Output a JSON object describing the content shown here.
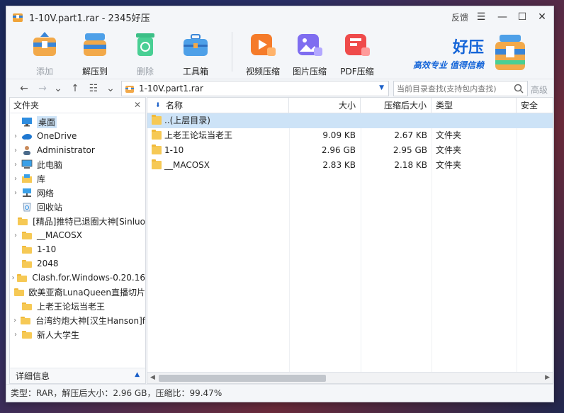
{
  "window": {
    "title": "1-10V.part1.rar - 2345好压",
    "feedback": "反馈"
  },
  "toolbar": {
    "add": "添加",
    "extract": "解压到",
    "delete": "删除",
    "tools": "工具箱",
    "video": "视频压缩",
    "image": "图片压缩",
    "pdf": "PDF压缩"
  },
  "brand": {
    "title": "好压",
    "slogan": "高效专业 值得信赖"
  },
  "address": {
    "path": "1-10V.part1.rar",
    "search_placeholder": "当前目录查找(支持包内查找)",
    "advanced": "高级"
  },
  "left_pane": {
    "header": "文件夹",
    "footer": "详细信息",
    "items": [
      {
        "label": "桌面",
        "icon": "desktop-icon",
        "expander": ""
      },
      {
        "label": "OneDrive",
        "icon": "cloud-icon",
        "expander": "›"
      },
      {
        "label": "Administrator",
        "icon": "user-icon",
        "expander": "›"
      },
      {
        "label": "此电脑",
        "icon": "computer-icon",
        "expander": "›"
      },
      {
        "label": "库",
        "icon": "library-icon",
        "expander": "›"
      },
      {
        "label": "网络",
        "icon": "network-icon",
        "expander": "›"
      },
      {
        "label": "回收站",
        "icon": "recycle-bin-icon",
        "expander": ""
      },
      {
        "label": "[精品]推特已退圈大神[Sinluo",
        "icon": "folder-icon",
        "expander": ""
      },
      {
        "label": "__MACOSX",
        "icon": "folder-icon",
        "expander": "›"
      },
      {
        "label": "1-10",
        "icon": "folder-icon",
        "expander": ""
      },
      {
        "label": "2048",
        "icon": "folder-icon",
        "expander": ""
      },
      {
        "label": "Clash.for.Windows-0.20.16",
        "icon": "folder-icon",
        "expander": "›"
      },
      {
        "label": "欧美亚裔LunaQueen直播切片",
        "icon": "folder-icon",
        "expander": ""
      },
      {
        "label": "上老王论坛当老王",
        "icon": "folder-icon",
        "expander": ""
      },
      {
        "label": "台湾约炮大神[汉生Hanson]f",
        "icon": "folder-icon",
        "expander": "›"
      },
      {
        "label": "新人大学生",
        "icon": "folder-icon",
        "expander": "›"
      }
    ]
  },
  "file_list": {
    "columns": [
      "名称",
      "大小",
      "压缩后大小",
      "类型",
      "安全"
    ],
    "rows": [
      {
        "name": "..(上层目录)",
        "size": "",
        "packed": "",
        "type": ""
      },
      {
        "name": "上老王论坛当老王",
        "size": "9.09 KB",
        "packed": "2.67 KB",
        "type": "文件夹"
      },
      {
        "name": "1-10",
        "size": "2.96 GB",
        "packed": "2.95 GB",
        "type": "文件夹"
      },
      {
        "name": "__MACOSX",
        "size": "2.83 KB",
        "packed": "2.18 KB",
        "type": "文件夹"
      }
    ]
  },
  "status": "类型：RAR，解压后大小：2.96 GB，压缩比：99.47%"
}
